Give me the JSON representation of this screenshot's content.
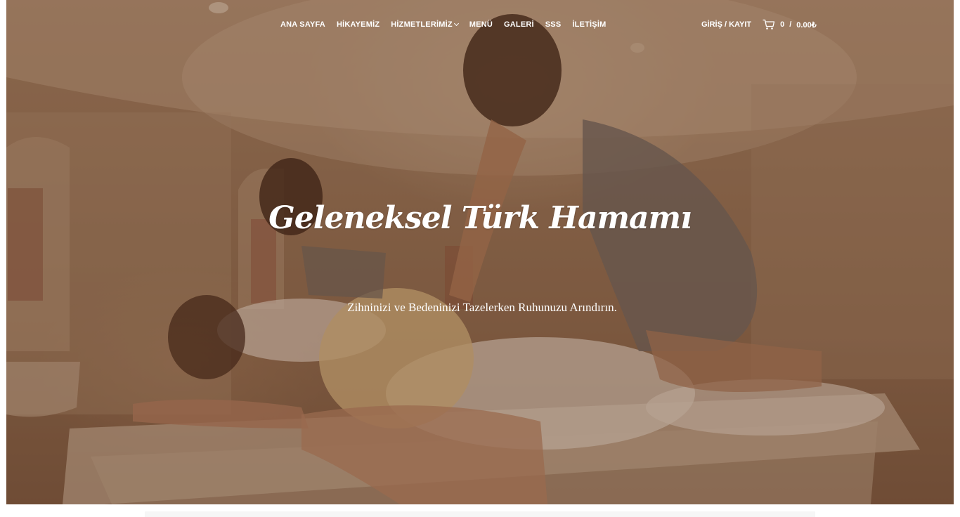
{
  "nav": {
    "items": [
      {
        "label": "ANA SAYFA"
      },
      {
        "label": "HİKAYEMİZ"
      },
      {
        "label": "HİZMETLERİMİZ",
        "has_dropdown": true
      },
      {
        "label": "MENÜ"
      },
      {
        "label": "GALERİ"
      },
      {
        "label": "SSS"
      },
      {
        "label": "İLETİŞİM"
      }
    ]
  },
  "account": {
    "login_label": "GİRİŞ / KAYIT",
    "cart_count": "0",
    "cart_total": "0.00₺",
    "cart_separator": "/",
    "cart_icon": "cart-icon"
  },
  "hero": {
    "title": "Geleneksel Türk Hamamı",
    "subtitle": "Zihninizi ve Bedeninizi Tazelerken Ruhunuzu Arındırın."
  },
  "colors": {
    "overlay": "#5c341e",
    "text": "#ffffff"
  }
}
